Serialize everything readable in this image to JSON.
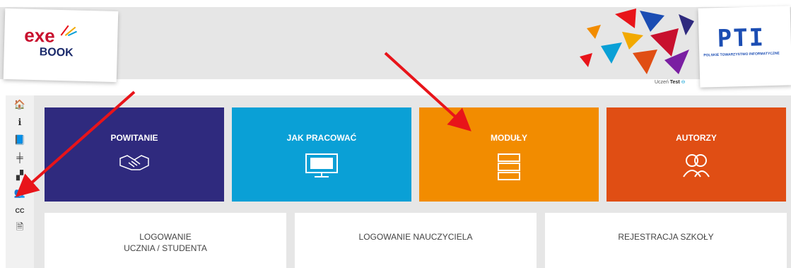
{
  "header": {
    "logo_top": "exe",
    "logo_bottom": "BOOK",
    "pti_logo": "PTI",
    "pti_caption": "POLSKIE TOWARZYSTWO INFORMATYCZNE",
    "user_role": "Uczeń",
    "user_name": "Test"
  },
  "sidebar": {
    "items": [
      {
        "icon": "home-icon",
        "glyph": "🏠"
      },
      {
        "icon": "info-icon",
        "glyph": "ℹ"
      },
      {
        "icon": "book-icon",
        "glyph": "📘"
      },
      {
        "icon": "signpost-icon",
        "glyph": "╪"
      },
      {
        "icon": "sitemap-icon",
        "glyph": "▞"
      },
      {
        "icon": "users-icon",
        "glyph": "👥"
      },
      {
        "icon": "cc-icon",
        "glyph": "CC"
      },
      {
        "icon": "file-icon",
        "glyph": "🗎"
      }
    ]
  },
  "tiles": [
    {
      "label": "POWITANIE",
      "color": "#2f2a7e",
      "icon": "handshake-icon"
    },
    {
      "label": "JAK PRACOWAĆ",
      "color": "#0aa0d6",
      "icon": "monitor-exebook-icon"
    },
    {
      "label": "MODUŁY",
      "color": "#f28c00",
      "icon": "stack-icon"
    },
    {
      "label": "AUTORZY",
      "color": "#e04e14",
      "icon": "authors-icon"
    }
  ],
  "login": {
    "student_line1": "LOGOWANIE",
    "student_line2": "UCZNIA / STUDENTA",
    "teacher": "LOGOWANIE NAUCZYCIELA",
    "register": "REJESTRACJA SZKOŁY"
  },
  "colors": {
    "arrow": "#e8141a"
  }
}
